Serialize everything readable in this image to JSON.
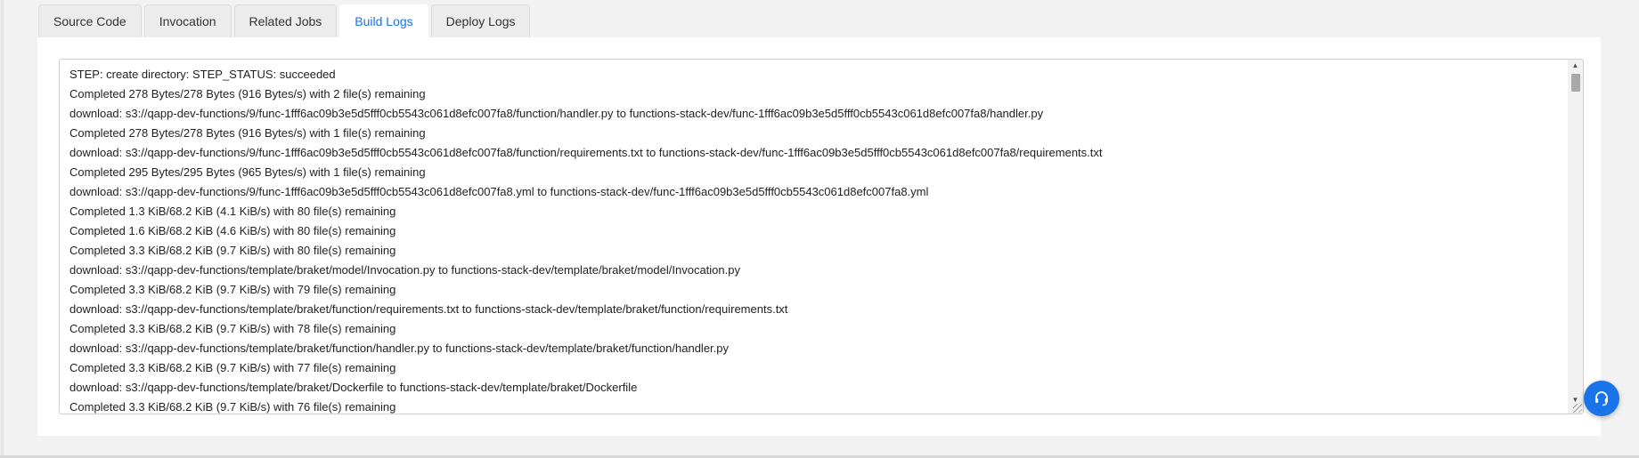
{
  "tabs": [
    {
      "label": "Source Code",
      "active": false
    },
    {
      "label": "Invocation",
      "active": false
    },
    {
      "label": "Related Jobs",
      "active": false
    },
    {
      "label": "Build Logs",
      "active": true
    },
    {
      "label": "Deploy Logs",
      "active": false
    }
  ],
  "logs": [
    "STEP: create directory: STEP_STATUS: succeeded",
    "Completed 278 Bytes/278 Bytes (916 Bytes/s) with 2 file(s) remaining",
    "download: s3://qapp-dev-functions/9/func-1fff6ac09b3e5d5fff0cb5543c061d8efc007fa8/function/handler.py to functions-stack-dev/func-1fff6ac09b3e5d5fff0cb5543c061d8efc007fa8/handler.py",
    "Completed 278 Bytes/278 Bytes (916 Bytes/s) with 1 file(s) remaining",
    "download: s3://qapp-dev-functions/9/func-1fff6ac09b3e5d5fff0cb5543c061d8efc007fa8/function/requirements.txt to functions-stack-dev/func-1fff6ac09b3e5d5fff0cb5543c061d8efc007fa8/requirements.txt",
    "Completed 295 Bytes/295 Bytes (965 Bytes/s) with 1 file(s) remaining",
    "download: s3://qapp-dev-functions/9/func-1fff6ac09b3e5d5fff0cb5543c061d8efc007fa8.yml to functions-stack-dev/func-1fff6ac09b3e5d5fff0cb5543c061d8efc007fa8.yml",
    "Completed 1.3 KiB/68.2 KiB (4.1 KiB/s) with 80 file(s) remaining",
    "Completed 1.6 KiB/68.2 KiB (4.6 KiB/s) with 80 file(s) remaining",
    "Completed 3.3 KiB/68.2 KiB (9.7 KiB/s) with 80 file(s) remaining",
    "download: s3://qapp-dev-functions/template/braket/model/Invocation.py to functions-stack-dev/template/braket/model/Invocation.py",
    "Completed 3.3 KiB/68.2 KiB (9.7 KiB/s) with 79 file(s) remaining",
    "download: s3://qapp-dev-functions/template/braket/function/requirements.txt to functions-stack-dev/template/braket/function/requirements.txt",
    "Completed 3.3 KiB/68.2 KiB (9.7 KiB/s) with 78 file(s) remaining",
    "download: s3://qapp-dev-functions/template/braket/function/handler.py to functions-stack-dev/template/braket/function/handler.py",
    "Completed 3.3 KiB/68.2 KiB (9.7 KiB/s) with 77 file(s) remaining",
    "download: s3://qapp-dev-functions/template/braket/Dockerfile to functions-stack-dev/template/braket/Dockerfile",
    "Completed 3.3 KiB/68.2 KiB (9.7 KiB/s) with 76 file(s) remaining"
  ],
  "icons": {
    "help": "headset-icon",
    "scroll_up": "arrow-up-icon",
    "scroll_down": "arrow-down-icon"
  },
  "colors": {
    "accent": "#1a73e8",
    "tab_inactive_bg": "#ececec",
    "page_bg": "#f2f2f2"
  }
}
